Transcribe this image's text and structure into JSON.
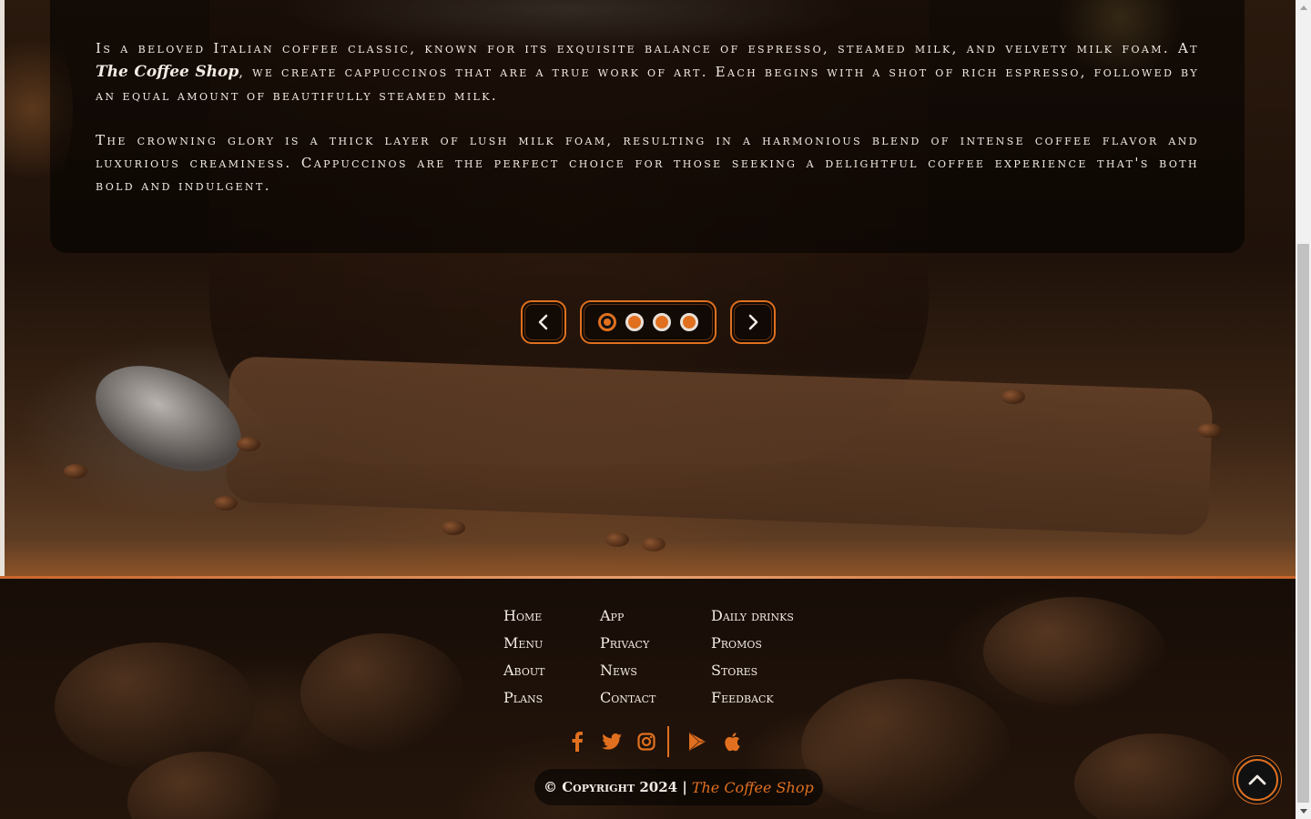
{
  "hero": {
    "paragraph1_before": "Is a beloved Italian coffee classic, known for its exquisite balance of espresso, steamed milk, and velvety milk foam. At ",
    "paragraph1_brand": "The Coffee Shop",
    "paragraph1_after": ", we create cappuccinos that are a true work of art. Each begins with a shot of rich espresso, followed by an equal amount of beautifully steamed milk.",
    "paragraph2": "The crowning glory is a thick layer of lush milk foam, resulting in a harmonious blend of intense coffee flavor and luxurious creaminess. Cappuccinos are the perfect choice for those seeking a delightful coffee experience that's both bold and indulgent."
  },
  "carousel": {
    "prev_icon": "chevron-left-icon",
    "next_icon": "chevron-right-icon",
    "slide_count": 4,
    "active_index": 0
  },
  "footer": {
    "columns": [
      [
        "Home",
        "Menu",
        "About",
        "Plans"
      ],
      [
        "App",
        "Privacy",
        "News",
        "Contact"
      ],
      [
        "Daily drinks",
        "Promos",
        "Stores",
        "Feedback"
      ]
    ],
    "social_icons": [
      "facebook-icon",
      "twitter-icon",
      "instagram-icon",
      "google-play-icon",
      "apple-icon"
    ],
    "copyright_text": "© Copyright 2024 |",
    "copyright_brand": "The Coffee Shop"
  },
  "scroll_top_icon": "chevron-up-icon",
  "colors": {
    "accent": "#e0701f",
    "text": "#f3ece4",
    "panel": "rgba(0,0,0,0.55)"
  }
}
